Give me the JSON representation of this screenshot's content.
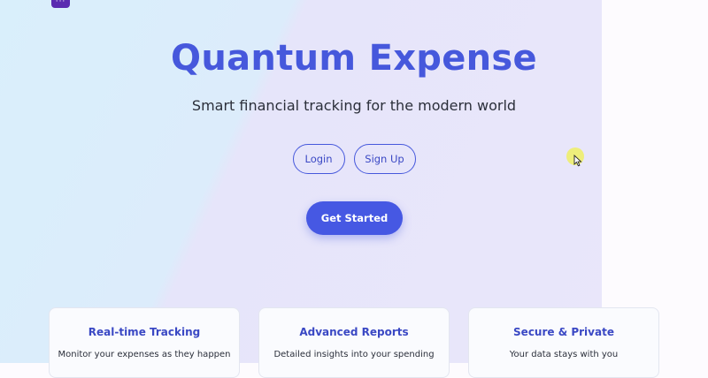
{
  "app": {
    "badge_icon": "more-dots-icon",
    "badge_glyph": "···"
  },
  "hero": {
    "title": "Quantum Expense",
    "subtitle": "Smart financial tracking for the modern world"
  },
  "auth": {
    "login_label": "Login",
    "signup_label": "Sign Up"
  },
  "cta": {
    "label": "Get Started"
  },
  "features": [
    {
      "title": "Real-time Tracking",
      "description": "Monitor your expenses as they happen"
    },
    {
      "title": "Advanced Reports",
      "description": "Detailed insights into your spending"
    },
    {
      "title": "Secure & Private",
      "description": "Your data stays with you"
    }
  ],
  "colors": {
    "accent": "#4658dc",
    "button_fill": "#4658e3",
    "badge": "#5b2bb0"
  }
}
